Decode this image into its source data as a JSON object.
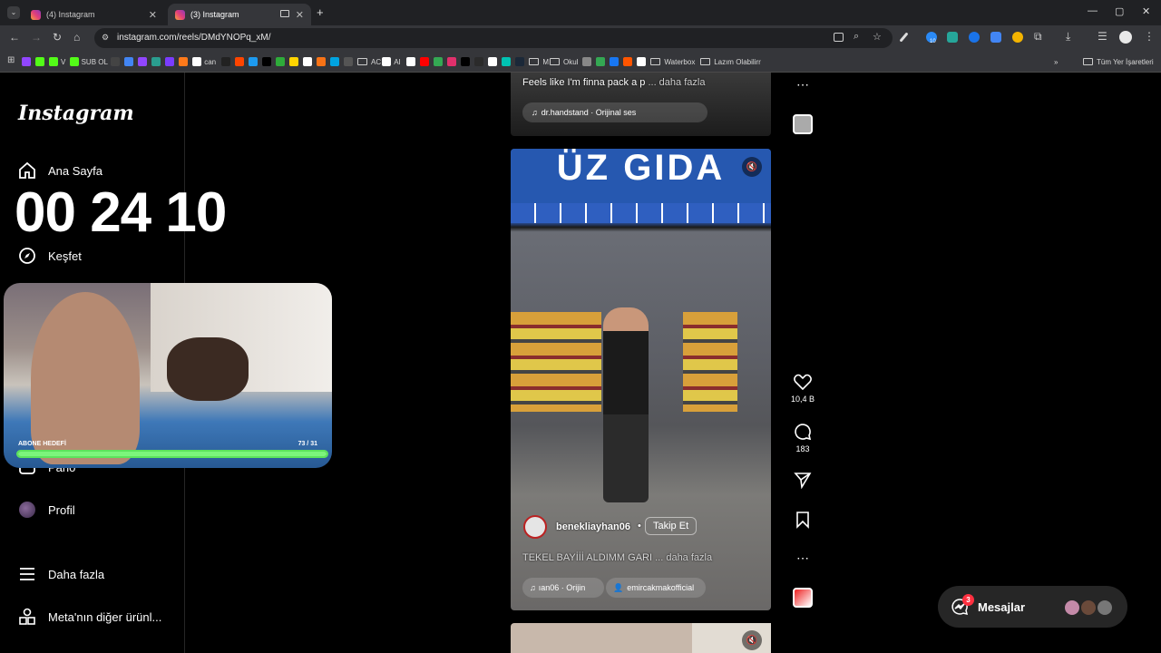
{
  "browser": {
    "tabs": [
      {
        "label": "(4) Instagram",
        "active": false
      },
      {
        "label": "(3) Instagram",
        "active": true
      }
    ],
    "new_tab": "+",
    "url": "instagram.com/reels/DMdYNOPq_xM/",
    "ext_badge": "10",
    "window_controls": [
      "—",
      "▢",
      "✕"
    ]
  },
  "bookmarks": [
    {
      "label": "",
      "color": "#9146ff"
    },
    {
      "label": "",
      "color": "#53fc18"
    },
    {
      "label": "V",
      "color": "#53fc18"
    },
    {
      "label": "SUB OL",
      "color": "#53fc18"
    },
    {
      "label": "",
      "color": "#444444"
    },
    {
      "label": "",
      "color": "#4285f4"
    },
    {
      "label": "",
      "color": "#9146ff"
    },
    {
      "label": "",
      "color": "#2a9d8f"
    },
    {
      "label": "",
      "color": "#7a3cff"
    },
    {
      "label": "",
      "color": "#ff7a1a"
    },
    {
      "label": "can",
      "color": "#ffffff"
    },
    {
      "label": "",
      "color": "#222222"
    },
    {
      "label": "",
      "color": "#ff4500"
    },
    {
      "label": "",
      "color": "#1d9bf0"
    },
    {
      "label": "",
      "color": "#000000"
    },
    {
      "label": "",
      "color": "#2eac3a"
    },
    {
      "label": "",
      "color": "#ffd400"
    },
    {
      "label": "",
      "color": "#ffffff"
    },
    {
      "label": "",
      "color": "#f97316"
    },
    {
      "label": "",
      "color": "#00a3e0"
    },
    {
      "label": "",
      "color": "#555555"
    },
    {
      "label": "AC",
      "color": "folder"
    },
    {
      "label": "AI",
      "color": "#ffffff"
    },
    {
      "label": "",
      "color": "#ffffff"
    },
    {
      "label": "",
      "color": "#ff0000"
    },
    {
      "label": "",
      "color": "#34a853"
    },
    {
      "label": "",
      "color": "#e1306c"
    },
    {
      "label": "",
      "color": "#000000"
    },
    {
      "label": "",
      "color": "#2b2b2b"
    },
    {
      "label": "",
      "color": "#ffffff"
    },
    {
      "label": "",
      "color": "#00c2b2"
    },
    {
      "label": "",
      "color": "#1b2838"
    },
    {
      "label": "M",
      "color": "folder"
    },
    {
      "label": "Okul",
      "color": "folder"
    },
    {
      "label": "",
      "color": "#888888"
    },
    {
      "label": "",
      "color": "#34a853"
    },
    {
      "label": "",
      "color": "#1877f2"
    },
    {
      "label": "",
      "color": "#ff5500"
    },
    {
      "label": "",
      "color": "#ffffff"
    },
    {
      "label": "Waterbox",
      "color": "folder"
    },
    {
      "label": "Lazım Olabilirr",
      "color": "folder"
    },
    {
      "label": "»",
      "color": "none"
    },
    {
      "label": "Tüm Yer İşaretleri",
      "color": "folder"
    }
  ],
  "sidebar": {
    "logo": "Instagram",
    "items": [
      {
        "label": "Ana Sayfa",
        "icon": "home-icon"
      },
      {
        "label": "Keşfet",
        "icon": "compass-icon"
      },
      {
        "label": "Pano",
        "icon": "dashboard-icon"
      },
      {
        "label": "Profil",
        "icon": "avatar"
      },
      {
        "label": "Daha fazla",
        "icon": "menu-icon"
      },
      {
        "label": "Meta'nın diğer ürünl...",
        "icon": "apps-icon"
      }
    ]
  },
  "overlay": {
    "timer": "00 24 10",
    "goal_label": "ABONE HEDEFİ",
    "goal_count": "73  / 31",
    "goal_progress": 1.0
  },
  "reels": {
    "previous": {
      "caption": "Feels like I'm finna pack a p",
      "more": "... daha fazla",
      "audio": "dr.handstand · Orijinal ses"
    },
    "current": {
      "sign": "ÜZ GIDA",
      "username": "benekliayhan06",
      "follow": "Takip Et",
      "caption": "TEKEL BAYİİİ ALDIMM GARI",
      "more": "... daha fazla",
      "audio": "ıan06 · Orijin",
      "tagged": "emircakmakofficial"
    }
  },
  "actions": {
    "likes": "10,4 B",
    "comments": "183"
  },
  "messages": {
    "label": "Mesajlar",
    "badge": "3"
  }
}
